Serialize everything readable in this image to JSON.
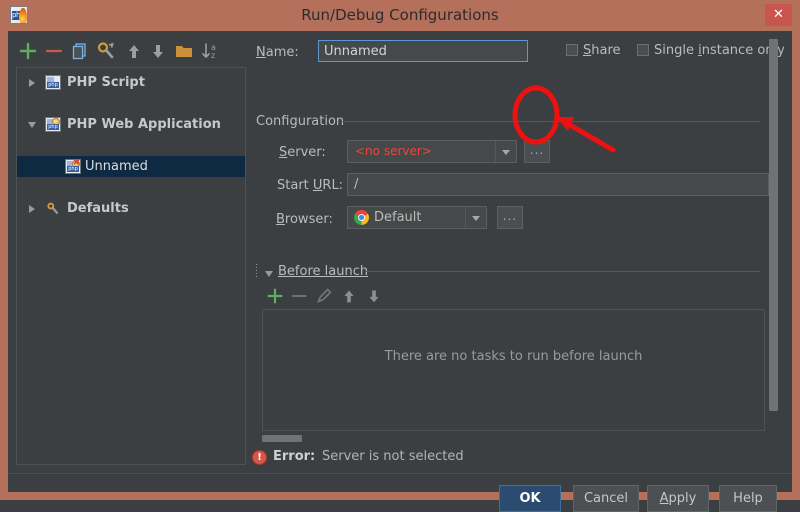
{
  "window": {
    "title": "Run/Debug Configurations",
    "close_label": "✕",
    "app_icon": "php-storm-icon",
    "frame_color": "#b5705c",
    "body_color": "#3c3f41"
  },
  "left_toolbar": {
    "buttons": [
      {
        "name": "add-configuration-button",
        "icon": "plus-icon",
        "glyph": "+",
        "color": "#5fad5f"
      },
      {
        "name": "remove-configuration-button",
        "icon": "minus-icon",
        "glyph": "−",
        "color": "#c75b4a"
      },
      {
        "name": "copy-configuration-button",
        "icon": "copy-icon",
        "glyph": "❐",
        "color": "#6d9fd0"
      },
      {
        "name": "edit-defaults-button",
        "icon": "wrench-icon",
        "glyph": "⚒",
        "color": "#c9913a"
      },
      {
        "name": "move-up-button",
        "icon": "arrow-up-icon",
        "glyph": "↑",
        "color": "#9a9a9a"
      },
      {
        "name": "move-down-button",
        "icon": "arrow-down-icon",
        "glyph": "↓",
        "color": "#9a9a9a"
      },
      {
        "name": "move-into-folder-button",
        "icon": "folder-icon",
        "glyph": "🗀",
        "color": "#c9913a"
      },
      {
        "name": "sort-alphabetically-button",
        "icon": "sort-az-icon",
        "glyph": "↓a̲z",
        "color": "#9a9a9a"
      }
    ]
  },
  "tree": {
    "items": [
      {
        "label": "PHP Script",
        "state": "collapsed",
        "indent": 0,
        "bold": true,
        "icon": "php-script-icon",
        "selected": false
      },
      {
        "label": "PHP Web Application",
        "state": "expanded",
        "indent": 0,
        "bold": true,
        "icon": "php-web-app-icon",
        "selected": false
      },
      {
        "label": "Unnamed",
        "state": "leaf",
        "indent": 1,
        "bold": false,
        "icon": "php-web-app-error-icon",
        "selected": true
      },
      {
        "label": "Defaults",
        "state": "collapsed",
        "indent": 0,
        "bold": true,
        "icon": "wrench-icon",
        "selected": false
      }
    ]
  },
  "form": {
    "name_label": "Name:",
    "name_label_mnemonic": "N",
    "name_value": "Unnamed",
    "share_label": "Share",
    "share_mnemonic": "S",
    "share_checked": false,
    "single_instance_label": "Single instance only",
    "single_instance_mnemonic": "i",
    "single_instance_checked": false,
    "configuration_group": "Configuration",
    "server_label": "Server:",
    "server_mnemonic": "S",
    "server_value": "<no server>",
    "server_value_color": "#e8483a",
    "server_browse_label": "...",
    "start_url_label": "Start URL:",
    "start_url_mnemonic": "U",
    "start_url_value": "/",
    "browser_label": "Browser:",
    "browser_mnemonic": "B",
    "browser_value": "Default",
    "browser_icon": "chrome-icon",
    "browser_browse_label": "..."
  },
  "before_launch": {
    "title": "Before launch",
    "title_mnemonic": "B",
    "expanded": true,
    "toolbar": [
      {
        "name": "add-task-button",
        "icon": "plus-icon",
        "glyph": "+",
        "color": "#5fad5f",
        "enabled": true
      },
      {
        "name": "remove-task-button",
        "icon": "minus-icon",
        "glyph": "−",
        "color": "#6e7275",
        "enabled": false
      },
      {
        "name": "edit-task-button",
        "icon": "pencil-icon",
        "glyph": "✎",
        "color": "#6e7275",
        "enabled": false
      },
      {
        "name": "task-move-up-button",
        "icon": "arrow-up-icon",
        "glyph": "↑",
        "color": "#8b8f92",
        "enabled": true
      },
      {
        "name": "task-move-down-button",
        "icon": "arrow-down-icon",
        "glyph": "↓",
        "color": "#8b8f92",
        "enabled": true
      }
    ],
    "empty_text": "There are no tasks to run before launch"
  },
  "status": {
    "error_icon": "error-icon",
    "error_label": "Error:",
    "error_message": "Server is not selected",
    "error_color": "#d4574a"
  },
  "buttons": {
    "ok": "OK",
    "cancel": "Cancel",
    "apply": "Apply",
    "apply_mnemonic": "A",
    "help": "Help"
  },
  "annotation": {
    "type": "red-highlight",
    "color": "#ee1111",
    "shapes": [
      "ellipse-around-server-browse-button",
      "arrow-pointing-to-server-browse-button"
    ]
  }
}
